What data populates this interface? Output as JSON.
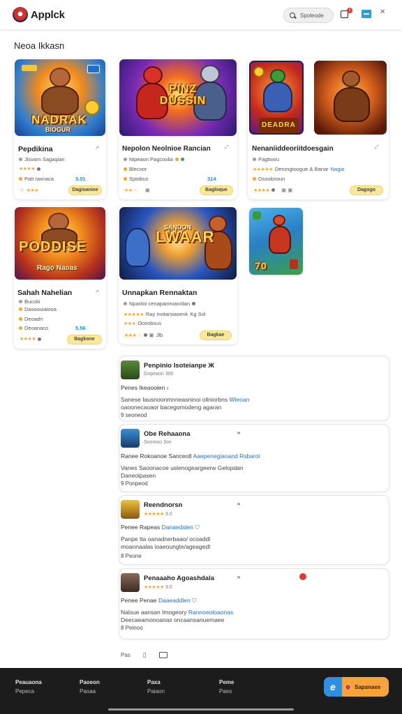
{
  "app": {
    "title": "Applck",
    "search_label": "Spoleode",
    "cart_badge": "1"
  },
  "section": {
    "title": "Neoa Ikkasn"
  },
  "cards": [
    {
      "art_title": "NADRAK",
      "art_sub": "BIOGUR",
      "title": "Pepdikina",
      "meta1": "Jlsvarn Sagaqian",
      "meta2": "Patt raxnaca",
      "price": "3.01",
      "button": "Dagioaniee"
    },
    {
      "art_title": "PINZ DUSSIN",
      "art_sub": "",
      "title": "Nepolon Neolnioe Rancian",
      "meta1": "Nipeaon Pagcoolia",
      "meta2": "Blecoor",
      "meta3": "Sptobus",
      "price": "314",
      "button": "Bagloque"
    },
    {
      "art_title": "DEADRA",
      "art_sub": "",
      "title": "Nenaniiddeoriitdoesgain",
      "meta1": "Pagboou",
      "meta2": "Derongtoogue & Banar",
      "meta2_link": "Nagia",
      "meta3": "Ossoloroun",
      "button": "Dagogo"
    },
    {
      "art_title": "",
      "art_sub": ""
    },
    {
      "art_title": "PODDISE",
      "art_sub": "Rago Naoas",
      "title": "Sahah Nahelian",
      "meta1": "Bucoki",
      "meta2": "Dasoouiaiooa",
      "meta3": "Deoadn",
      "meta4": "Deoanaco",
      "price": "5.56",
      "button": "Bagkone"
    },
    {
      "art_title": "LWAAR",
      "art_sub": "SANDON",
      "title": "Unnapkan Rennaktan",
      "meta1": "Npaoloi cenapanmian/dan",
      "meta2": "Ray Inotarsiaoenk",
      "meta2b": "Kg Sol",
      "meta3": "Oceobsus",
      "meta4": "Jlb",
      "button": "Bagkae"
    },
    {
      "art_title": "70",
      "art_sub": ""
    }
  ],
  "reviews": [
    {
      "name": "Penpinio Isoteianpe Ж",
      "sub": "Gnpeaon 300",
      "head": "Penes Ikeaoolen",
      "body1": "Sanese Iausnoonmnneasninoi ollniorbns",
      "body1_link": "Wleoan",
      "body2": "oaoonecaoaor bacegomodeng agaran",
      "foot": "9 seoneod"
    },
    {
      "name": "Obe Rehaaona",
      "sub": "Snoroso 3on",
      "head": "Ranee Rokoanoe Sanceotl",
      "head_link": "Aaepenegiaoand Rsbaroi",
      "body1": "Vanes Saoonacoe uslenogeargeerw Gelopdan",
      "body2": "Daneolpasen",
      "foot": "9 Ponpeod"
    },
    {
      "name": "Reendnorsn",
      "sub": "3.0",
      "head": "Penee Rapeas",
      "head_link": "Danaedslen",
      "body1": "Panpe Ita oanadnerbaao/ ocoaddl",
      "body2": "moannaalas ioaeoungte/ageagedl",
      "foot": "8 Peone"
    },
    {
      "name": "Penaaaho Agoashdala",
      "sub": "3.0",
      "head": "Penee Penae",
      "head_link": "Daaeaddlen",
      "body1": "Nalsue aansan Imogeory",
      "body1_link": "Rannoeoloaonas",
      "body2": "Deecaeamonoanas oncaansanuemaee",
      "foot": "8 Peinoo"
    }
  ],
  "pager": {
    "label": "Pas"
  },
  "footer": {
    "columns": [
      {
        "head": "Peauaona",
        "sub": "Pepeca"
      },
      {
        "head": "Paoeon",
        "sub": "Paoaa"
      },
      {
        "head": "Paxa",
        "sub": "Paiaon"
      },
      {
        "head": "Peme",
        "sub": "Paes"
      }
    ],
    "cta_label": "Sapanaes"
  },
  "colors": {
    "accent": "#1e88e5",
    "star": "#f5a623",
    "button_bg": "#fce89a",
    "footer_bg": "#1c1c1c",
    "cta_bg": "#f6a33a"
  }
}
